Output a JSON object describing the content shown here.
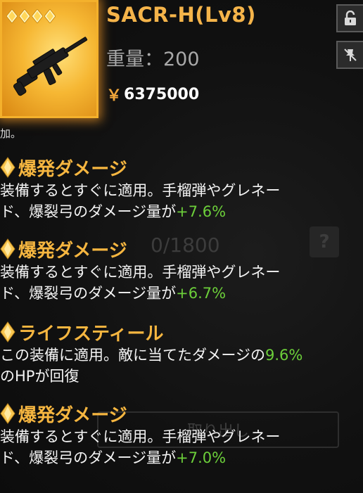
{
  "item": {
    "name": "SACR-H(Lv8)",
    "weight_text": "重量：200",
    "price_symbol": "￥",
    "price_value": "6375000",
    "star_count": 4,
    "rarity_color": "#f4b12c"
  },
  "buttons": {
    "lock_icon": "lock-icon",
    "pin_icon": "pin-off-icon"
  },
  "snippet_text": "加。",
  "background": {
    "ghost_text": "0/1800",
    "ghost_badge": "?",
    "ghost_button": "取り出し"
  },
  "effects": [
    {
      "name": "爆発ダメージ",
      "line1": "装備するとすぐに適用。手榴弾やグレネー",
      "line2_prefix": "ド、爆裂弓のダメージ量が",
      "value": "+7.6%",
      "line2_suffix": ""
    },
    {
      "name": "爆発ダメージ",
      "line1": "装備するとすぐに適用。手榴弾やグレネー",
      "line2_prefix": "ド、爆裂弓のダメージ量が",
      "value": "+6.7%",
      "line2_suffix": ""
    },
    {
      "name": "ライフスティール",
      "line1_prefix": "この装備に適用。敵に当てたダメージの",
      "value": "9.6%",
      "line2": "のHPが回復"
    },
    {
      "name": "爆発ダメージ",
      "line1": "装備するとすぐに適用。手榴弾やグレネー",
      "line2_prefix": "ド、爆裂弓のダメージ量が",
      "value": "+7.0%",
      "line2_suffix": ""
    }
  ],
  "colors": {
    "accent_orange": "#f6b640",
    "value_green": "#6ccf3a",
    "weight_gray": "#a9a9a9"
  }
}
